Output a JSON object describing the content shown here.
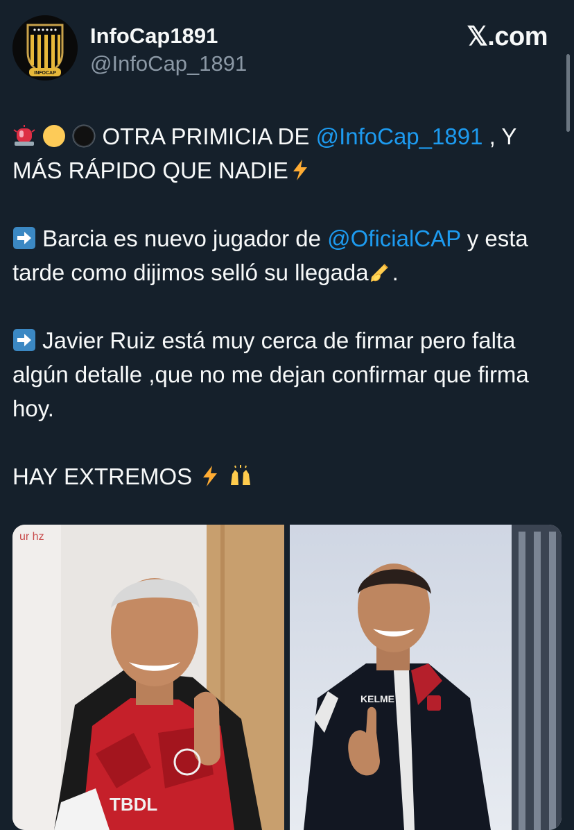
{
  "header": {
    "display_name": "InfoCap1891",
    "handle": "@InfoCap_1891",
    "brand": "𝕏.com",
    "avatar_text": "INFOCAP"
  },
  "tweet": {
    "line1_text": " OTRA PRIMICIA DE ",
    "line1_mention": "@InfoCap_1891",
    "line1_tail": " , Y MÁS RÁPIDO QUE NADIE",
    "p2_text": " Barcia es nuevo jugador de ",
    "p2_mention": "@OficialCAP",
    "p2_tail": " y esta tarde como dijimos selló su llegada",
    "p2_end": ".",
    "p3_text": " Javier Ruiz está muy cerca de firmar pero falta algún detalle ,que no me dejan confirmar que firma hoy.",
    "p4_text": "HAY EXTREMOS "
  },
  "media": {
    "left_photo_shirt_text": "TBDL",
    "right_photo_jacket_text": "KELME"
  },
  "icons": {
    "siren": "police-light-icon",
    "yellow": "yellow-circle-icon",
    "black": "black-circle-icon",
    "bolt": "high-voltage-icon",
    "arrow": "right-arrow-icon",
    "write": "writing-hand-icon",
    "hands": "raising-hands-icon"
  },
  "colors": {
    "background": "#15202b",
    "text": "#f7f9f9",
    "muted": "#8b98a5",
    "link": "#1d9bf0"
  }
}
